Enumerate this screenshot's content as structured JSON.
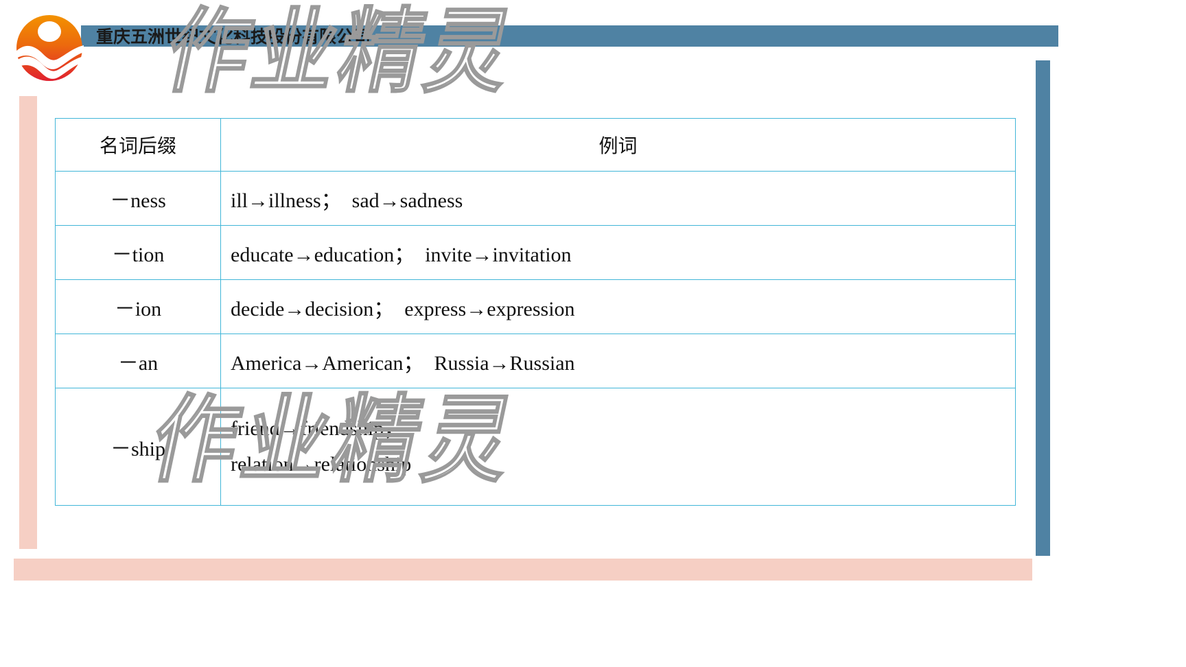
{
  "header": {
    "company_name": "重庆五洲世纪文化科技股份有限公司",
    "logo_icon": "sunrise-wave-logo-icon",
    "accent_blue": "#4f82a3",
    "accent_pink": "#f6cfc4",
    "logo_orange": "#f08018",
    "logo_red": "#e0212f"
  },
  "watermark": {
    "text": "作业精灵",
    "color": "#9a9a9a"
  },
  "table": {
    "border_color": "#41b6d8",
    "columns": [
      "名词后缀",
      "例词"
    ],
    "rows": [
      {
        "suffix": "－ness",
        "examples": [
          "ill→illness；　sad→sadness"
        ]
      },
      {
        "suffix": "－tion",
        "examples": [
          "educate→education；　invite→invitation"
        ]
      },
      {
        "suffix": "－ion",
        "examples": [
          "decide→decision；　express→expression"
        ]
      },
      {
        "suffix": "－an",
        "examples": [
          "America→American；　Russia→Russian"
        ]
      },
      {
        "suffix": "－ship",
        "examples": [
          "friend→friendship；",
          "relation→relationship"
        ]
      }
    ]
  }
}
